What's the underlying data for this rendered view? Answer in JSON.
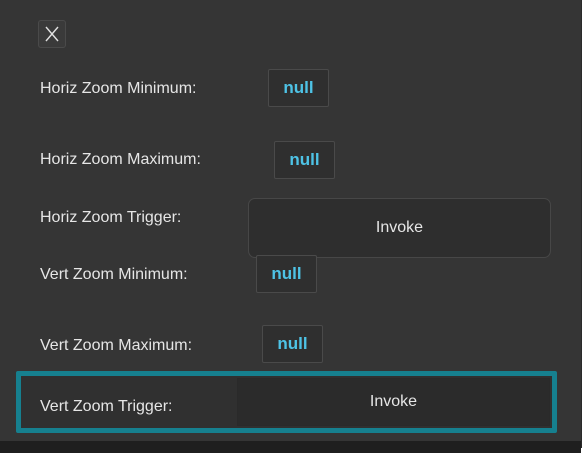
{
  "close_icon": "close-x-icon",
  "accent_color": "#16808f",
  "value_color": "#4ec3e6",
  "rows": {
    "horiz_min": {
      "label": "Horiz Zoom Minimum:",
      "value": "null"
    },
    "horiz_max": {
      "label": "Horiz Zoom Maximum:",
      "value": "null"
    },
    "horiz_trigger": {
      "label": "Horiz Zoom Trigger:",
      "button": "Invoke"
    },
    "vert_min": {
      "label": "Vert Zoom Minimum:",
      "value": "null"
    },
    "vert_max": {
      "label": "Vert Zoom Maximum:",
      "value": "null"
    },
    "vert_trigger": {
      "label": "Vert Zoom Trigger:",
      "button": "Invoke"
    }
  }
}
